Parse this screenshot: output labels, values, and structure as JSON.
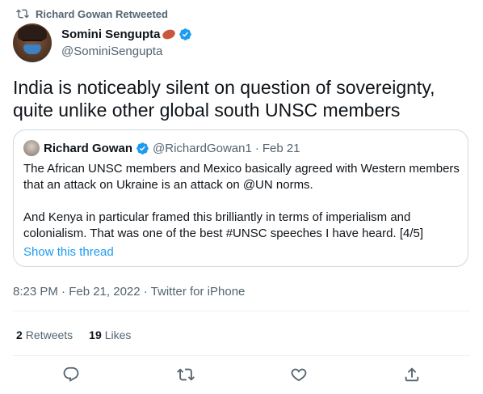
{
  "retweet_bar": {
    "retweeter": "Richard Gowan",
    "suffix": "Retweeted",
    "text": "Richard Gowan Retweeted"
  },
  "tweet": {
    "display_name": "Somini Sengupta",
    "handle": "@SominiSengupta",
    "text": "India is noticeably silent on question of sovereignty, quite unlike other global south UNSC members",
    "timestamp": "8:23 PM · Feb 21, 2022 · Twitter for iPhone"
  },
  "quote": {
    "display_name": "Richard Gowan",
    "handle": "@RichardGowan1",
    "separator": "·",
    "date": "Feb 21",
    "paragraph1": "The African UNSC members and Mexico basically agreed with Western members that an attack on Ukraine is an attack on @UN norms.",
    "paragraph2": "And Kenya in particular framed this brilliantly in terms of imperialism and colonialism. That was one of the best #UNSC speeches I have heard. [4/5]",
    "show_thread": "Show this thread"
  },
  "stats": {
    "retweets_count": "2",
    "retweets_label": "Retweets",
    "likes_count": "19",
    "likes_label": "Likes"
  },
  "actions": [
    "reply-icon",
    "retweet-icon",
    "like-icon",
    "share-icon"
  ],
  "colors": {
    "accent": "#1d9bf0",
    "muted": "#536471",
    "text": "#0f1419",
    "border": "#cfd9de"
  }
}
